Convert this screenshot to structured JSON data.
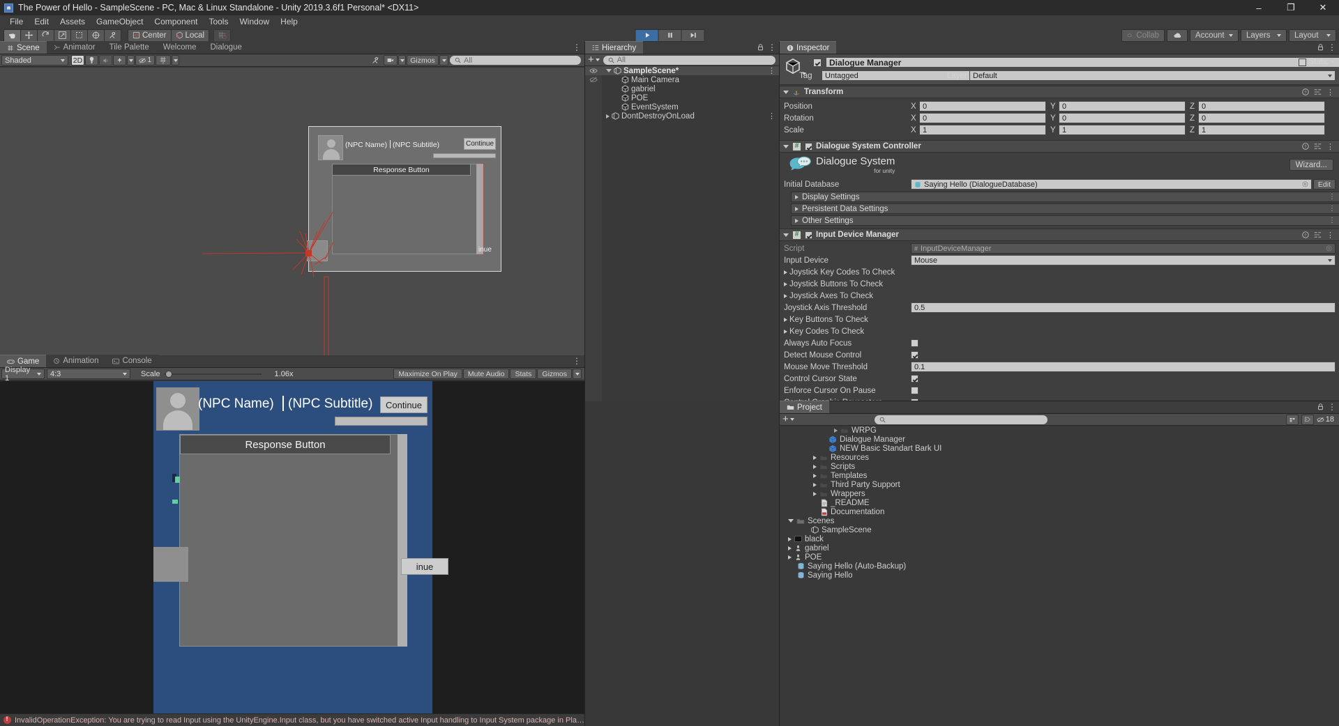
{
  "window": {
    "title": "The Power of Hello - SampleScene - PC, Mac & Linux Standalone - Unity 2019.3.6f1 Personal* <DX11>",
    "minimize": "–",
    "maximize": "❐",
    "close": "✕"
  },
  "menubar": {
    "items": [
      "File",
      "Edit",
      "Assets",
      "GameObject",
      "Component",
      "Tools",
      "Window",
      "Help"
    ]
  },
  "toolbar": {
    "tools": [
      "hand-tool",
      "move-tool",
      "rotate-tool",
      "scale-tool",
      "rect-tool",
      "transform-tool",
      "custom-tool"
    ],
    "pivot_mode": "Center",
    "pivot_rotation": "Local",
    "play": "▶",
    "pause": "❙❙",
    "step": "▶❙",
    "collab": "Collab",
    "account": "Account",
    "layers": "Layers",
    "layout": "Layout"
  },
  "scene_panel": {
    "tabs": [
      "Scene",
      "Animator",
      "Tile Palette",
      "Welcome",
      "Dialogue"
    ],
    "active_tab": "Scene",
    "draw_mode": "Shaded",
    "two_d": "2D",
    "audio_count": "1",
    "gizmos": "Gizmos",
    "search_placeholder": "All"
  },
  "hierarchy": {
    "title": "Hierarchy",
    "add_label": "+",
    "search_placeholder": "All",
    "items": [
      {
        "label": "SampleScene*",
        "depth": 0,
        "type": "scene",
        "expanded": true,
        "bold": true
      },
      {
        "label": "Main Camera",
        "depth": 1,
        "type": "gameobject"
      },
      {
        "label": "gabriel",
        "depth": 1,
        "type": "gameobject"
      },
      {
        "label": "POE",
        "depth": 1,
        "type": "gameobject"
      },
      {
        "label": "EventSystem",
        "depth": 1,
        "type": "gameobject"
      },
      {
        "label": "DontDestroyOnLoad",
        "depth": 0,
        "type": "scene",
        "expanded": false
      }
    ]
  },
  "inspector": {
    "title": "Inspector",
    "object_name": "Dialogue Manager",
    "object_enabled": true,
    "static_label": "Static",
    "tag_label": "Tag",
    "tag_value": "Untagged",
    "layer_label": "Layer",
    "layer_value": "Default",
    "transform": {
      "title": "Transform",
      "rows": [
        {
          "label": "Position",
          "x": "0",
          "y": "0",
          "z": "0"
        },
        {
          "label": "Rotation",
          "x": "0",
          "y": "0",
          "z": "0"
        },
        {
          "label": "Scale",
          "x": "1",
          "y": "1",
          "z": "1"
        }
      ],
      "axis_labels": [
        "X",
        "Y",
        "Z"
      ]
    },
    "dialogue_system_controller": {
      "title": "Dialogue System Controller",
      "enabled": true,
      "logo_title": "Dialogue System",
      "logo_subtitle": "for unity",
      "wizard_button": "Wizard...",
      "initial_database_label": "Initial Database",
      "initial_database_value": "Saying Hello (DialogueDatabase)",
      "edit_button": "Edit",
      "foldouts": [
        "Display Settings",
        "Persistent Data Settings",
        "Other Settings"
      ]
    },
    "input_device_manager": {
      "title": "Input Device Manager",
      "enabled": true,
      "rows": [
        {
          "label": "Script",
          "value": "InputDeviceManager",
          "kind": "object",
          "muted": true
        },
        {
          "label": "Input Device",
          "value": "Mouse",
          "kind": "dropdown"
        },
        {
          "label": "Joystick Key Codes To Check",
          "kind": "foldout"
        },
        {
          "label": "Joystick Buttons To Check",
          "kind": "foldout"
        },
        {
          "label": "Joystick Axes To Check",
          "kind": "foldout"
        },
        {
          "label": "Joystick Axis Threshold",
          "value": "0.5",
          "kind": "text"
        },
        {
          "label": "Key Buttons To Check",
          "kind": "foldout"
        },
        {
          "label": "Key Codes To Check",
          "kind": "foldout"
        },
        {
          "label": "Always Auto Focus",
          "kind": "checkbox",
          "checked": false
        },
        {
          "label": "Detect Mouse Control",
          "kind": "checkbox",
          "checked": true
        },
        {
          "label": "Mouse Move Threshold",
          "value": "0.1",
          "kind": "text"
        },
        {
          "label": "Control Cursor State",
          "kind": "checkbox",
          "checked": true
        },
        {
          "label": "Enforce Cursor On Pause",
          "kind": "checkbox",
          "checked": false
        },
        {
          "label": "Control Graphic Raycasters",
          "kind": "checkbox",
          "checked": false
        }
      ]
    }
  },
  "game_panel": {
    "tabs": [
      "Game",
      "Animation",
      "Console"
    ],
    "active_tab": "Game",
    "display": "Display 1",
    "aspect": "4:3",
    "scale_label": "Scale",
    "scale_value": "1.06x",
    "maximize_on_play": "Maximize On Play",
    "mute_audio": "Mute Audio",
    "stats": "Stats",
    "gizmos": "Gizmos"
  },
  "dialogue_ui": {
    "npc_name": "(NPC Name)",
    "npc_subtitle": "(NPC Subtitle)",
    "continue_label": "Continue",
    "response_button": "Response Button"
  },
  "project": {
    "title": "Project",
    "add_label": "+",
    "search_placeholder": "",
    "badge_count": "18",
    "items": [
      {
        "label": "WRPG",
        "depth": 3,
        "type": "folder",
        "collapsed": true
      },
      {
        "label": "Dialogue Manager",
        "depth": 3,
        "type": "prefab"
      },
      {
        "label": "NEW Basic Standart Bark UI",
        "depth": 3,
        "type": "prefab"
      },
      {
        "label": "Resources",
        "depth": 2,
        "type": "folder",
        "collapsed": true
      },
      {
        "label": "Scripts",
        "depth": 2,
        "type": "folder",
        "collapsed": true
      },
      {
        "label": "Templates",
        "depth": 2,
        "type": "folder",
        "collapsed": true
      },
      {
        "label": "Third Party Support",
        "depth": 2,
        "type": "folder",
        "collapsed": true
      },
      {
        "label": "Wrappers",
        "depth": 2,
        "type": "folder",
        "collapsed": true
      },
      {
        "label": "_README",
        "depth": 2,
        "type": "text"
      },
      {
        "label": "Documentation",
        "depth": 2,
        "type": "pdf"
      },
      {
        "label": "Scenes",
        "depth": 1,
        "type": "folder",
        "expanded": true
      },
      {
        "label": "SampleScene",
        "depth": 2,
        "type": "scene"
      },
      {
        "label": "black",
        "depth": 1,
        "type": "material-black",
        "collapsed": true
      },
      {
        "label": "gabriel",
        "depth": 1,
        "type": "model",
        "collapsed": true
      },
      {
        "label": "POE",
        "depth": 1,
        "type": "model",
        "collapsed": true
      },
      {
        "label": "Saying Hello (Auto-Backup)",
        "depth": 1,
        "type": "asset"
      },
      {
        "label": "Saying Hello",
        "depth": 1,
        "type": "asset"
      }
    ]
  },
  "status": {
    "message": "InvalidOperationException: You are trying to read Input using the UnityEngine.Input class, but you have switched active Input handling to Input System package in Player Settings."
  },
  "colors": {
    "accent_blue": "#3a6ea5",
    "panel_bg": "#393939",
    "toolbar_bg": "#3c3c3c",
    "error_red": "#c63b3b",
    "game_bg": "#2b4e7e"
  }
}
